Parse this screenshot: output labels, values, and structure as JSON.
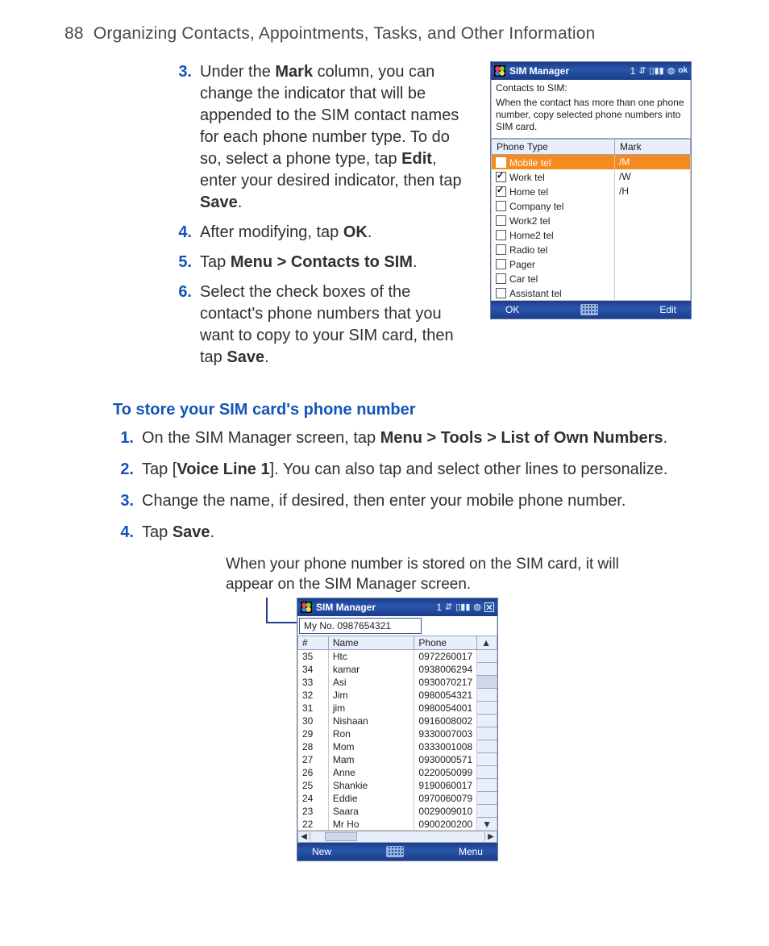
{
  "page": {
    "number": "88",
    "title": "Organizing Contacts, Appointments, Tasks, and Other Information"
  },
  "steps_top": [
    {
      "n": "3.",
      "pre": "Under the ",
      "b1": "Mark",
      "mid1": " column, you can change the indicator that will be appended to the SIM contact names for each phone number type. To do so, select a phone type, tap ",
      "b2": "Edit",
      "mid2": ", enter your desired indicator, then tap ",
      "b3": "Save",
      "post": "."
    },
    {
      "n": "4.",
      "pre": "After modifying, tap ",
      "b1": "OK",
      "post": "."
    },
    {
      "n": "5.",
      "pre": "Tap ",
      "b1": "Menu > Contacts to SIM",
      "post": "."
    },
    {
      "n": "6.",
      "pre": "Select the check boxes of the contact's phone numbers that you want to copy to your SIM card, then tap ",
      "b1": "Save",
      "post": "."
    }
  ],
  "subhead": "To store your SIM card's phone number",
  "steps_bottom": [
    {
      "n": "1.",
      "pre": "On the SIM Manager screen, tap ",
      "b1": "Menu > Tools > List of Own Numbers",
      "post": "."
    },
    {
      "n": "2.",
      "pre": "Tap [",
      "b1": "Voice Line 1",
      "post": "]. You can also tap and select other lines to personalize."
    },
    {
      "n": "3.",
      "pre": "Change the name, if desired, then enter your mobile phone number.",
      "b1": "",
      "post": ""
    },
    {
      "n": "4.",
      "pre": "Tap ",
      "b1": "Save",
      "post": "."
    }
  ],
  "caption": "When your phone number is stored on the SIM card, it will appear on the SIM Manager screen.",
  "shot1": {
    "title": "SIM Manager",
    "status_num": "1",
    "ok": "ok",
    "heading": "Contacts to SIM:",
    "desc": "When the contact has more than one phone number, copy selected phone numbers into SIM card.",
    "col_phone": "Phone Type",
    "col_mark": "Mark",
    "rows": [
      {
        "checked": true,
        "label": "Mobile tel",
        "mark": "/M",
        "selected": true
      },
      {
        "checked": true,
        "label": "Work tel",
        "mark": "/W"
      },
      {
        "checked": true,
        "label": "Home tel",
        "mark": "/H"
      },
      {
        "checked": false,
        "label": "Company tel",
        "mark": ""
      },
      {
        "checked": false,
        "label": "Work2 tel",
        "mark": ""
      },
      {
        "checked": false,
        "label": "Home2 tel",
        "mark": ""
      },
      {
        "checked": false,
        "label": "Radio tel",
        "mark": ""
      },
      {
        "checked": false,
        "label": "Pager",
        "mark": ""
      },
      {
        "checked": false,
        "label": "Car tel",
        "mark": ""
      },
      {
        "checked": false,
        "label": "Assistant tel",
        "mark": ""
      }
    ],
    "soft_left": "OK",
    "soft_right": "Edit"
  },
  "shot2": {
    "title": "SIM Manager",
    "status_num": "1",
    "myno": "My No. 0987654321",
    "col_hash": "#",
    "col_name": "Name",
    "col_phone": "Phone",
    "rows": [
      {
        "n": "35",
        "name": "Htc",
        "phone": "0972260017"
      },
      {
        "n": "34",
        "name": "kamar",
        "phone": "0938006294"
      },
      {
        "n": "33",
        "name": "Asi",
        "phone": "0930070217"
      },
      {
        "n": "32",
        "name": "Jim",
        "phone": "0980054321"
      },
      {
        "n": "31",
        "name": "jim",
        "phone": "0980054001"
      },
      {
        "n": "30",
        "name": "Nishaan",
        "phone": "0916008002"
      },
      {
        "n": "29",
        "name": "Ron",
        "phone": "9330007003"
      },
      {
        "n": "28",
        "name": "Mom",
        "phone": "0333001008"
      },
      {
        "n": "27",
        "name": "Mam",
        "phone": "0930000571"
      },
      {
        "n": "26",
        "name": "Anne",
        "phone": "0220050099"
      },
      {
        "n": "25",
        "name": "Shankie",
        "phone": "9190060017"
      },
      {
        "n": "24",
        "name": "Eddie",
        "phone": "0970060079"
      },
      {
        "n": "23",
        "name": "Saara",
        "phone": "0029009010"
      },
      {
        "n": "22",
        "name": "Mr Ho",
        "phone": "0900200200"
      }
    ],
    "soft_left": "New",
    "soft_right": "Menu"
  }
}
